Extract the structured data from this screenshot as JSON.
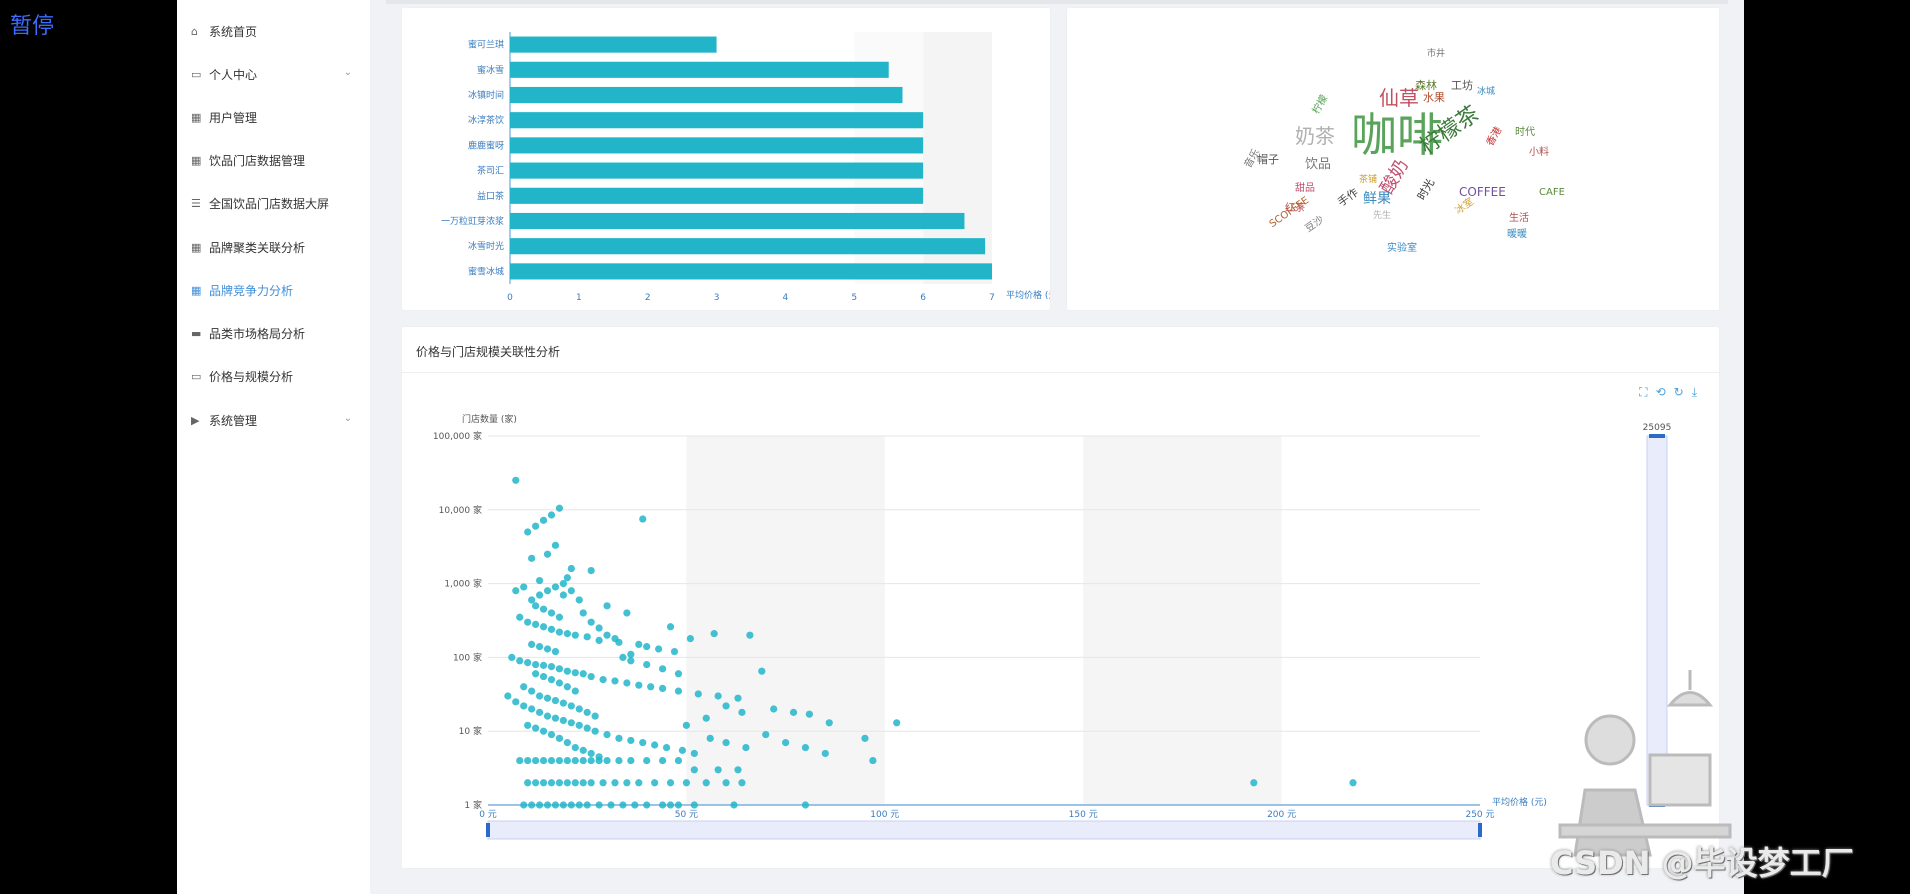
{
  "overlay": {
    "pause_label": "暂停",
    "watermark": "CSDN @毕设梦工厂"
  },
  "sidebar": {
    "items": [
      {
        "label": "系统首页",
        "icon": "home-icon"
      },
      {
        "label": "个人中心",
        "icon": "card-icon",
        "expandable": true
      },
      {
        "label": "用户管理",
        "icon": "grid-icon"
      },
      {
        "label": "饮品门店数据管理",
        "icon": "grid-icon"
      },
      {
        "label": "全国饮品门店数据大屏",
        "icon": "list-icon"
      },
      {
        "label": "品牌聚类关联分析",
        "icon": "grid-icon"
      },
      {
        "label": "品牌竞争力分析",
        "icon": "grid-icon",
        "active": true
      },
      {
        "label": "品类市场格局分析",
        "icon": "chat-icon"
      },
      {
        "label": "价格与规模分析",
        "icon": "monitor-icon"
      },
      {
        "label": "系统管理",
        "icon": "video-icon",
        "expandable": true
      }
    ]
  },
  "colors": {
    "accent": "#22b5c9",
    "active": "#3f8fd8",
    "background": "#f0f2f5"
  },
  "bar_chart": {
    "chart_data": {
      "type": "bar",
      "orientation": "horizontal",
      "categories": [
        "蜜雪冰城",
        "冰雪时光",
        "一万粒豇芽浓浆",
        "益口茶",
        "茶司汇",
        "鹿鹿蜜呀",
        "冰淳茶饮",
        "冰镇时间",
        "蜜冰雪",
        "蜜可兰琪"
      ],
      "values": [
        7.0,
        6.9,
        6.6,
        6.0,
        6.0,
        6.0,
        6.0,
        5.7,
        5.5,
        3.0
      ],
      "xlabel": "平均价格 (元)",
      "xlim": [
        0,
        7
      ],
      "xticks": [
        "0",
        "1",
        "2",
        "3",
        "4",
        "5",
        "6",
        "7"
      ],
      "grid": false,
      "color": "#22b5c9"
    }
  },
  "word_cloud": {
    "words": [
      {
        "t": "咖啡",
        "c": "#5aa35a"
      },
      {
        "t": "奶茶",
        "c": "#b0b0b0"
      },
      {
        "t": "柠檬茶",
        "c": "#3a7a3a"
      },
      {
        "t": "酸奶",
        "c": "#c05070"
      },
      {
        "t": "鲜果",
        "c": "#3a8ac0"
      },
      {
        "t": "仙草",
        "c": "#c05060"
      },
      {
        "t": "饮品",
        "c": "#777"
      },
      {
        "t": "COFFEE",
        "c": "#7050a0"
      },
      {
        "t": "时光",
        "c": "#333"
      },
      {
        "t": "手作",
        "c": "#444"
      },
      {
        "t": "森林",
        "c": "#5a7a2a"
      },
      {
        "t": "水果",
        "c": "#b05030"
      },
      {
        "t": "工坊",
        "c": "#555"
      },
      {
        "t": "香港",
        "c": "#c03030"
      },
      {
        "t": "时代",
        "c": "#5a8a3a"
      },
      {
        "t": "小料",
        "c": "#b05050"
      },
      {
        "t": "冰室",
        "c": "#d0a030"
      },
      {
        "t": "帽子",
        "c": "#555"
      },
      {
        "t": "音乐",
        "c": "#777"
      },
      {
        "t": "实验室",
        "c": "#3a8ac0"
      },
      {
        "t": "红茶",
        "c": "#c04040"
      },
      {
        "t": "生活",
        "c": "#b05050"
      },
      {
        "t": "CAFE",
        "c": "#5a8a3a"
      },
      {
        "t": "SCOFFEE",
        "c": "#b06030"
      },
      {
        "t": "暖暖",
        "c": "#3a8ac0"
      },
      {
        "t": "市井",
        "c": "#777"
      },
      {
        "t": "先生",
        "c": "#b0b0b0"
      },
      {
        "t": "茶铺",
        "c": "#d0a030"
      },
      {
        "t": "柠檬",
        "c": "#5aa35a"
      },
      {
        "t": "冰城",
        "c": "#3a8ac0"
      },
      {
        "t": "豆沙",
        "c": "#777"
      },
      {
        "t": "甜品",
        "c": "#c05070"
      }
    ]
  },
  "scatter": {
    "title": "价格与门店规模关联性分析",
    "toolbox_icons": [
      "zoom-icon",
      "zoom-back-icon",
      "restore-icon",
      "download-icon"
    ],
    "chart_data": {
      "type": "scatter",
      "xlabel": "平均价格 (元)",
      "ylabel": "门店数量 (家)",
      "x_scale": "linear",
      "y_scale": "log",
      "xlim": [
        0,
        250
      ],
      "ylim": [
        1,
        100000
      ],
      "xticks": [
        "0 元",
        "50 元",
        "100 元",
        "150 元",
        "200 元",
        "250 元"
      ],
      "yticks": [
        "1 家",
        "10 家",
        "100 家",
        "1,000 家",
        "10,000 家",
        "100,000 家"
      ],
      "slider_max_label": "25095",
      "color": "#22b5c9",
      "points": [
        [
          7,
          25095
        ],
        [
          18,
          10500
        ],
        [
          16,
          8500
        ],
        [
          14,
          7200
        ],
        [
          12,
          6000
        ],
        [
          10,
          5000
        ],
        [
          39,
          7500
        ],
        [
          17,
          3300
        ],
        [
          15,
          2500
        ],
        [
          11,
          2200
        ],
        [
          21,
          1600
        ],
        [
          26,
          1500
        ],
        [
          20,
          1200
        ],
        [
          13,
          1100
        ],
        [
          9,
          900
        ],
        [
          7,
          800
        ],
        [
          19,
          700
        ],
        [
          23,
          600
        ],
        [
          30,
          500
        ],
        [
          35,
          400
        ],
        [
          8,
          350
        ],
        [
          10,
          300
        ],
        [
          12,
          280
        ],
        [
          14,
          260
        ],
        [
          16,
          240
        ],
        [
          18,
          220
        ],
        [
          20,
          210
        ],
        [
          22,
          200
        ],
        [
          25,
          190
        ],
        [
          28,
          170
        ],
        [
          33,
          160
        ],
        [
          38,
          150
        ],
        [
          40,
          140
        ],
        [
          43,
          130
        ],
        [
          46,
          260
        ],
        [
          57,
          210
        ],
        [
          66,
          200
        ],
        [
          51,
          180
        ],
        [
          47,
          120
        ],
        [
          36,
          110
        ],
        [
          6,
          100
        ],
        [
          8,
          90
        ],
        [
          10,
          85
        ],
        [
          12,
          80
        ],
        [
          14,
          78
        ],
        [
          16,
          75
        ],
        [
          18,
          70
        ],
        [
          20,
          65
        ],
        [
          22,
          62
        ],
        [
          24,
          60
        ],
        [
          26,
          55
        ],
        [
          29,
          50
        ],
        [
          32,
          48
        ],
        [
          35,
          45
        ],
        [
          38,
          42
        ],
        [
          41,
          40
        ],
        [
          44,
          38
        ],
        [
          48,
          35
        ],
        [
          53,
          32
        ],
        [
          58,
          30
        ],
        [
          63,
          28
        ],
        [
          69,
          65
        ],
        [
          72,
          20
        ],
        [
          77,
          18
        ],
        [
          81,
          17
        ],
        [
          86,
          13
        ],
        [
          60,
          22
        ],
        [
          64,
          18
        ],
        [
          55,
          15
        ],
        [
          50,
          12
        ],
        [
          5,
          30
        ],
        [
          7,
          25
        ],
        [
          9,
          22
        ],
        [
          11,
          20
        ],
        [
          13,
          18
        ],
        [
          15,
          16
        ],
        [
          17,
          15
        ],
        [
          19,
          14
        ],
        [
          21,
          13
        ],
        [
          23,
          12
        ],
        [
          25,
          11
        ],
        [
          27,
          10
        ],
        [
          30,
          9
        ],
        [
          33,
          8
        ],
        [
          36,
          7.5
        ],
        [
          39,
          7
        ],
        [
          42,
          6.5
        ],
        [
          45,
          6
        ],
        [
          49,
          5.5
        ],
        [
          52,
          5
        ],
        [
          56,
          8
        ],
        [
          60,
          7
        ],
        [
          65,
          6
        ],
        [
          70,
          9
        ],
        [
          75,
          7
        ],
        [
          80,
          6
        ],
        [
          85,
          5
        ],
        [
          95,
          8
        ],
        [
          97,
          4
        ],
        [
          103,
          13
        ],
        [
          8,
          4
        ],
        [
          10,
          4
        ],
        [
          12,
          4
        ],
        [
          14,
          4
        ],
        [
          16,
          4
        ],
        [
          18,
          4
        ],
        [
          20,
          4
        ],
        [
          22,
          4
        ],
        [
          24,
          4
        ],
        [
          26,
          4
        ],
        [
          28,
          4
        ],
        [
          30,
          4
        ],
        [
          33,
          4
        ],
        [
          36,
          4
        ],
        [
          40,
          4
        ],
        [
          44,
          4
        ],
        [
          48,
          4
        ],
        [
          52,
          3
        ],
        [
          58,
          3
        ],
        [
          63,
          3
        ],
        [
          10,
          2
        ],
        [
          12,
          2
        ],
        [
          14,
          2
        ],
        [
          16,
          2
        ],
        [
          18,
          2
        ],
        [
          20,
          2
        ],
        [
          22,
          2
        ],
        [
          24,
          2
        ],
        [
          26,
          2
        ],
        [
          29,
          2
        ],
        [
          32,
          2
        ],
        [
          35,
          2
        ],
        [
          38,
          2
        ],
        [
          42,
          2
        ],
        [
          46,
          2
        ],
        [
          50,
          2
        ],
        [
          55,
          2
        ],
        [
          60,
          2
        ],
        [
          64,
          2
        ],
        [
          193,
          2
        ],
        [
          218,
          2
        ],
        [
          11,
          1
        ],
        [
          13,
          1
        ],
        [
          15,
          1
        ],
        [
          17,
          1
        ],
        [
          19,
          1
        ],
        [
          21,
          1
        ],
        [
          23,
          1
        ],
        [
          25,
          1
        ],
        [
          28,
          1
        ],
        [
          31,
          1
        ],
        [
          34,
          1
        ],
        [
          37,
          1
        ],
        [
          40,
          1
        ],
        [
          44,
          1
        ],
        [
          48,
          1
        ],
        [
          52,
          1
        ],
        [
          62,
          1
        ],
        [
          80,
          1
        ],
        [
          46,
          1
        ],
        [
          9,
          1
        ],
        [
          11,
          150
        ],
        [
          13,
          140
        ],
        [
          15,
          130
        ],
        [
          17,
          120
        ],
        [
          12,
          60
        ],
        [
          14,
          55
        ],
        [
          16,
          50
        ],
        [
          18,
          45
        ],
        [
          20,
          40
        ],
        [
          22,
          35
        ],
        [
          9,
          40
        ],
        [
          11,
          35
        ],
        [
          13,
          30
        ],
        [
          15,
          28
        ],
        [
          17,
          26
        ],
        [
          19,
          24
        ],
        [
          21,
          22
        ],
        [
          23,
          20
        ],
        [
          25,
          18
        ],
        [
          27,
          16
        ],
        [
          12,
          500
        ],
        [
          14,
          450
        ],
        [
          16,
          400
        ],
        [
          18,
          350
        ],
        [
          11,
          600
        ],
        [
          13,
          700
        ],
        [
          15,
          800
        ],
        [
          17,
          900
        ],
        [
          19,
          1000
        ],
        [
          21,
          800
        ],
        [
          24,
          400
        ],
        [
          26,
          300
        ],
        [
          28,
          250
        ],
        [
          30,
          200
        ],
        [
          32,
          180
        ],
        [
          34,
          100
        ],
        [
          36,
          90
        ],
        [
          40,
          80
        ],
        [
          44,
          70
        ],
        [
          48,
          60
        ],
        [
          10,
          12
        ],
        [
          12,
          11
        ],
        [
          14,
          10
        ],
        [
          16,
          9
        ],
        [
          18,
          8
        ],
        [
          20,
          7
        ],
        [
          22,
          6
        ],
        [
          24,
          5.5
        ],
        [
          26,
          5
        ],
        [
          28,
          4.5
        ]
      ]
    }
  }
}
